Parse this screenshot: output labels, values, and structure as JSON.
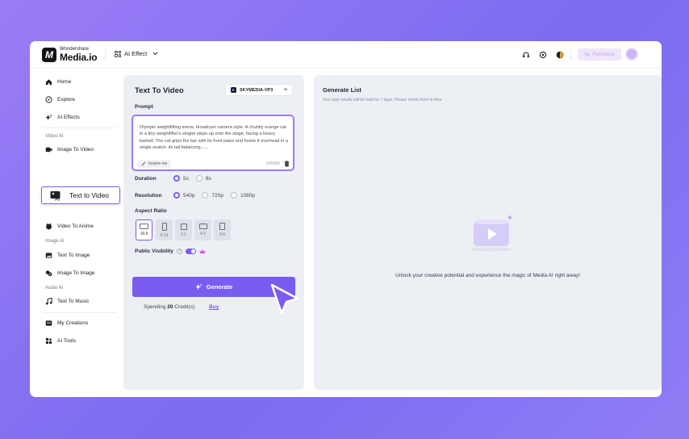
{
  "header": {
    "logo_top": "Wondershare",
    "logo_main": "Media.io",
    "logo_mark": "M",
    "ai_effect_label": "AI Effect",
    "purchase_label": "Purchase"
  },
  "sidebar": {
    "items_top": [
      {
        "label": "Home",
        "icon": "home-icon"
      },
      {
        "label": "Explore",
        "icon": "compass-icon"
      },
      {
        "label": "AI Effects",
        "icon": "sparkle-icon"
      }
    ],
    "video_ai_label": "Video AI",
    "video_items": [
      {
        "label": "Image To Video",
        "icon": "image-video-icon"
      },
      {
        "label": "Text to Video",
        "icon": "ai-text-video-icon",
        "active": true
      },
      {
        "label": "Video To Anime",
        "icon": "anime-icon"
      }
    ],
    "image_ai_label": "Image AI",
    "image_items": [
      {
        "label": "Text To Image",
        "icon": "text-image-icon"
      },
      {
        "label": "Image To Image",
        "icon": "image-image-icon"
      }
    ],
    "audio_ai_label": "Audio AI",
    "audio_items": [
      {
        "label": "Text To Music",
        "icon": "music-icon"
      }
    ],
    "items_bottom": [
      {
        "label": "My Creations",
        "icon": "folder-icon"
      },
      {
        "label": "AI Tools",
        "icon": "tools-icon"
      }
    ]
  },
  "form": {
    "title": "Text To Video",
    "model": "SKYMEDIA-VP3",
    "prompt_label": "Prompt",
    "prompt_text": "Olympic weightlifting arena, broadcast camera style. A chubby orange cat in a tiny weightlifter's singlet steps up onto the stage, facing a heavy barbell. The cat grips the bar with its front paws and hoists it overhead in a single snatch, its tail balancing......",
    "inspire_label": "Inspire me",
    "char_count": "0/5000",
    "duration_label": "Duration",
    "duration_options": [
      "5s",
      "8s"
    ],
    "duration_selected": "5s",
    "resolution_label": "Resolution",
    "resolution_options": [
      "540p",
      "720p",
      "1080p"
    ],
    "resolution_selected": "540p",
    "aspect_label": "Aspect Ratio",
    "aspect_options": [
      "16:9",
      "9:16",
      "1:1",
      "4:3",
      "3:4"
    ],
    "aspect_selected": "16:9",
    "visibility_label": "Public Visibility",
    "visibility_on": true,
    "generate_label": "Generate",
    "spend_prefix": "Spending",
    "spend_credits": "20",
    "spend_suffix": "Credit(s)",
    "buy_label": "Buy"
  },
  "results": {
    "title": "Generate List",
    "subtitle": "Your task results will be kept for 7 days. Please check them in time",
    "empty_message": "Unlock your creative potential and experience the magic of Media AI right away!"
  },
  "colors": {
    "accent": "#7b5cf0",
    "panel_bg": "#eceff4",
    "background_gradient": "#9b7cf6"
  }
}
